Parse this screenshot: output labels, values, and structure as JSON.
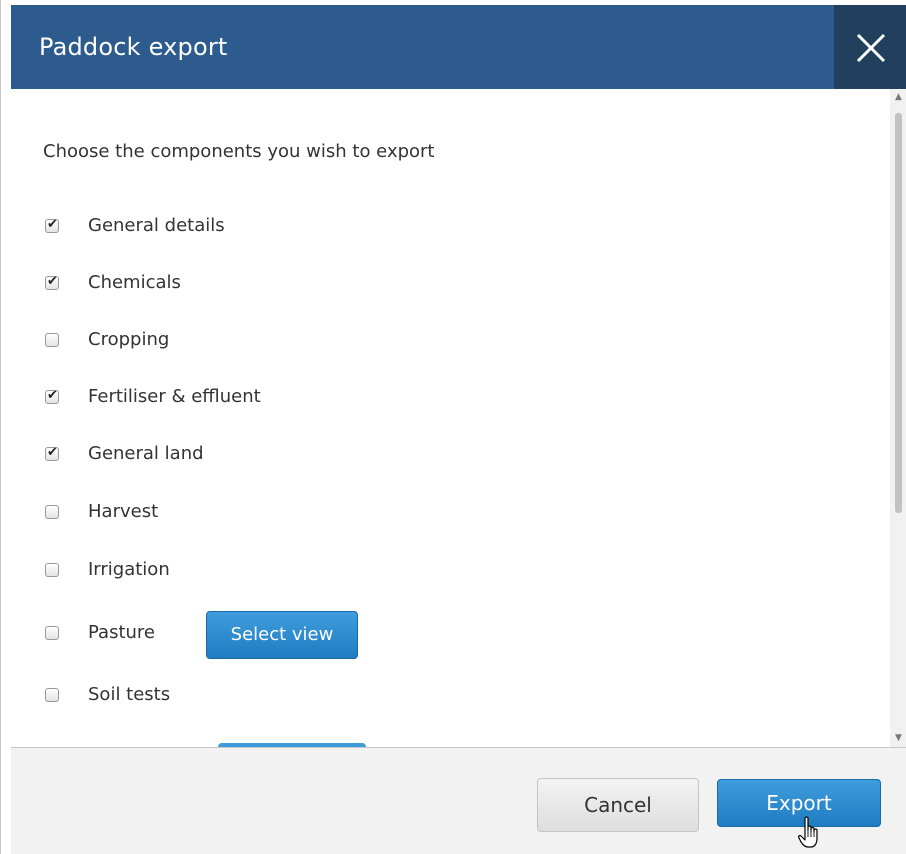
{
  "dialog": {
    "title": "Paddock export",
    "close_icon": "close-icon"
  },
  "body": {
    "intro": "Choose the components you wish to export",
    "options": [
      {
        "label": "General details",
        "checked": true
      },
      {
        "label": "Chemicals",
        "checked": true
      },
      {
        "label": "Cropping",
        "checked": false
      },
      {
        "label": "Fertiliser & effluent",
        "checked": true
      },
      {
        "label": "General land",
        "checked": true
      },
      {
        "label": "Harvest",
        "checked": false
      },
      {
        "label": "Irrigation",
        "checked": false
      },
      {
        "label": "Pasture",
        "checked": false
      },
      {
        "label": "Soil tests",
        "checked": false
      }
    ],
    "select_view_label": "Select view"
  },
  "footer": {
    "cancel_label": "Cancel",
    "export_label": "Export"
  },
  "colors": {
    "header_bg": "#2e5b8e",
    "close_bg": "#223f5e",
    "primary_button": "#2a86c9"
  }
}
